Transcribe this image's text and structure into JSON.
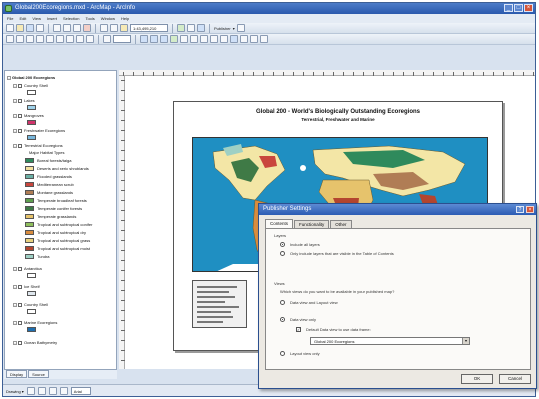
{
  "window": {
    "title": "Global200Ecoregions.mxd - ArcMap - ArcInfo"
  },
  "menu": [
    "File",
    "Edit",
    "View",
    "Insert",
    "Selection",
    "Tools",
    "Window",
    "Help"
  ],
  "toolbar": {
    "scale_value": "1:43,495,210",
    "publisher_label": "Publisher",
    "publisher_caret": "▾"
  },
  "toc": {
    "items": [
      {
        "label": "Global 200 Ecoregions",
        "swatch": null
      },
      {
        "label": "Country Shell",
        "swatch": "#ffffff"
      },
      {
        "label": "Lakes",
        "swatch": "#9fd2ea"
      },
      {
        "label": "Mangroves",
        "swatch": "#d0346b"
      },
      {
        "label": "Freshwater Ecoregions",
        "swatch": "#78b7dc"
      },
      {
        "label": "Terrestrial Ecoregions",
        "swatch": null
      },
      {
        "label": "Major Habitat Types",
        "swatch": null
      },
      {
        "label": "Boreal forests/taiga",
        "swatch": "#2f8a5c"
      },
      {
        "label": "Deserts and xeric shrublands",
        "swatch": "#f4e09e"
      },
      {
        "label": "Flooded grasslands",
        "swatch": "#6ab0a5"
      },
      {
        "label": "Mediterranean scrub",
        "swatch": "#c9463d"
      },
      {
        "label": "Montane grasslands",
        "swatch": "#b07d55"
      },
      {
        "label": "Temperate broadleaf forests",
        "swatch": "#5f9f4f"
      },
      {
        "label": "Temperate conifer forests",
        "swatch": "#3f7a46"
      },
      {
        "label": "Temperate grasslands",
        "swatch": "#e6c36c"
      },
      {
        "label": "Tropical and subtropical conifer",
        "swatch": "#8fbf5d"
      },
      {
        "label": "Tropical and subtropical dry",
        "swatch": "#d98c3e"
      },
      {
        "label": "Tropical and subtropical grass",
        "swatch": "#e8d27f"
      },
      {
        "label": "Tropical and subtropical moist",
        "swatch": "#b3452f"
      },
      {
        "label": "Tundra",
        "swatch": "#9ed0c4"
      },
      {
        "label": "Antarctica",
        "swatch": "#ffffff"
      },
      {
        "label": "Ice Shelf",
        "swatch": "#dfe7ee"
      },
      {
        "label": "Country Shell",
        "swatch": "#ffffff"
      },
      {
        "label": "Marine Ecoregions",
        "swatch": "#1f6fb0"
      },
      {
        "label": "Ocean Bathymetry",
        "swatch": "#2b8fc9"
      }
    ],
    "tabs": [
      "Display",
      "Source"
    ]
  },
  "layout": {
    "title": "Global 200 - World's Biologically Outstanding Ecoregions",
    "subtitle": "Terrestrial, Freshwater and Marine"
  },
  "statusbar": {
    "drawing_label": "Drawing ▾",
    "font_value": "Arial"
  },
  "dialog": {
    "title": "Publisher Settings",
    "tabs": [
      "Contents",
      "Functionality",
      "Other"
    ],
    "layers_heading": "Layers",
    "radio_include_all": "Include all layers",
    "radio_toc_only": "Only include layers that are visible in the Table of Contents",
    "views_heading": "Views",
    "views_question": "Which views do you want to be available in your published map?",
    "radio_data_and_layout": "Data view and Layout view",
    "radio_data_only": "Data view only",
    "checkbox_default_frame": "Default Data view to use data frame:",
    "select_frame": "Global 200 Ecoregions",
    "radio_layout_only": "Layout view only",
    "ok_label": "OK",
    "cancel_label": "Cancel"
  }
}
